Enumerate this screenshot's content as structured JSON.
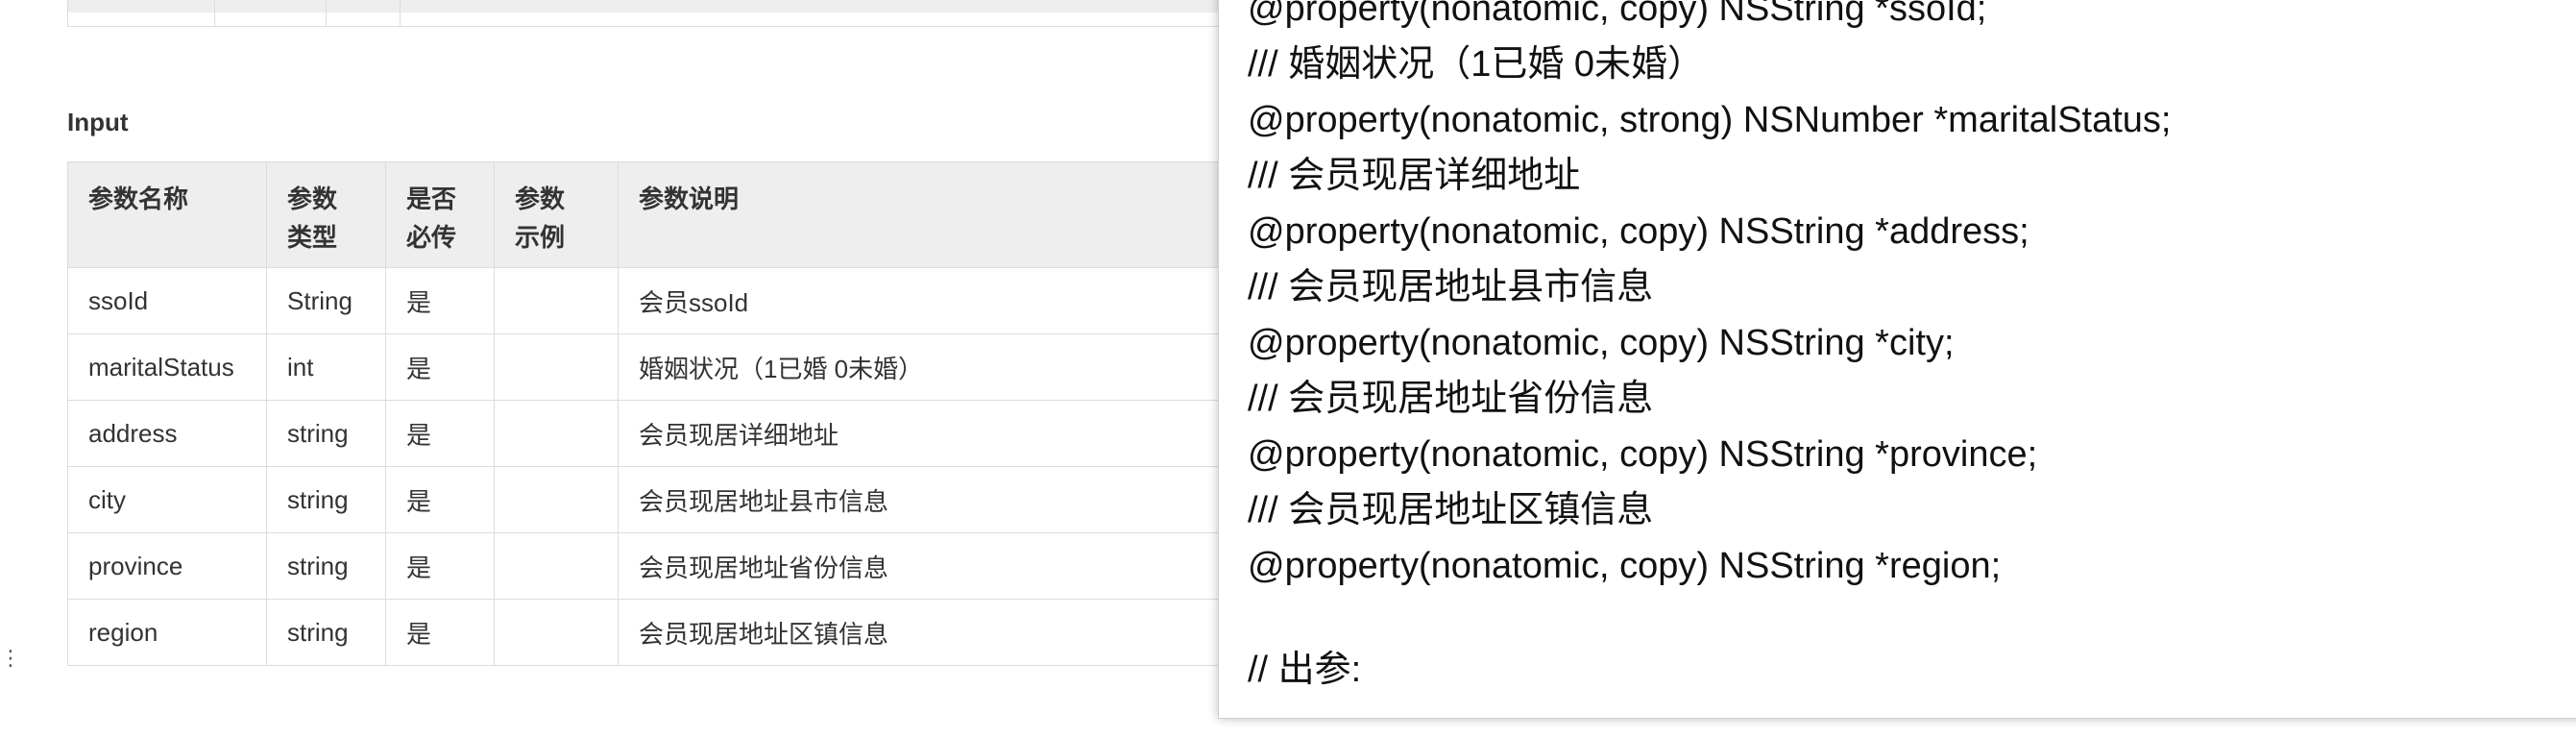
{
  "section_title": "Input",
  "table": {
    "headers": [
      "参数名称\n",
      "参数\n类型",
      "是否\n必传",
      "参数\n示例",
      "参数说明"
    ],
    "rows": [
      {
        "name": "ssoId",
        "type": "String",
        "required": "是",
        "example": "",
        "desc": "会员ssoId"
      },
      {
        "name": "maritalStatus",
        "type": "int",
        "required": "是",
        "example": "",
        "desc": "婚姻状况（1已婚 0未婚）"
      },
      {
        "name": "address",
        "type": "string",
        "required": "是",
        "example": "",
        "desc": "会员现居详细地址"
      },
      {
        "name": "city",
        "type": "string",
        "required": "是",
        "example": "",
        "desc": "会员现居地址县市信息"
      },
      {
        "name": "province",
        "type": "string",
        "required": "是",
        "example": "",
        "desc": "会员现居地址省份信息"
      },
      {
        "name": "region",
        "type": "string",
        "required": "是",
        "example": "",
        "desc": "会员现居地址区镇信息"
      }
    ]
  },
  "code_panel": {
    "lines": [
      "@property(nonatomic, copy) NSString *ssoId;",
      "/// 婚姻状况（1已婚 0未婚）",
      "@property(nonatomic, strong) NSNumber *maritalStatus;",
      "/// 会员现居详细地址",
      "@property(nonatomic, copy) NSString *address;",
      "/// 会员现居地址县市信息",
      "@property(nonatomic, copy) NSString *city;",
      "/// 会员现居地址省份信息",
      "@property(nonatomic, copy) NSString *province;",
      "/// 会员现居地址区镇信息",
      "@property(nonatomic, copy) NSString *region;",
      "",
      "// 出参:"
    ]
  },
  "colors": {
    "header_bg": "#eeeeee",
    "border": "#dcdcdc",
    "text": "#333333",
    "code_text": "#111111"
  }
}
